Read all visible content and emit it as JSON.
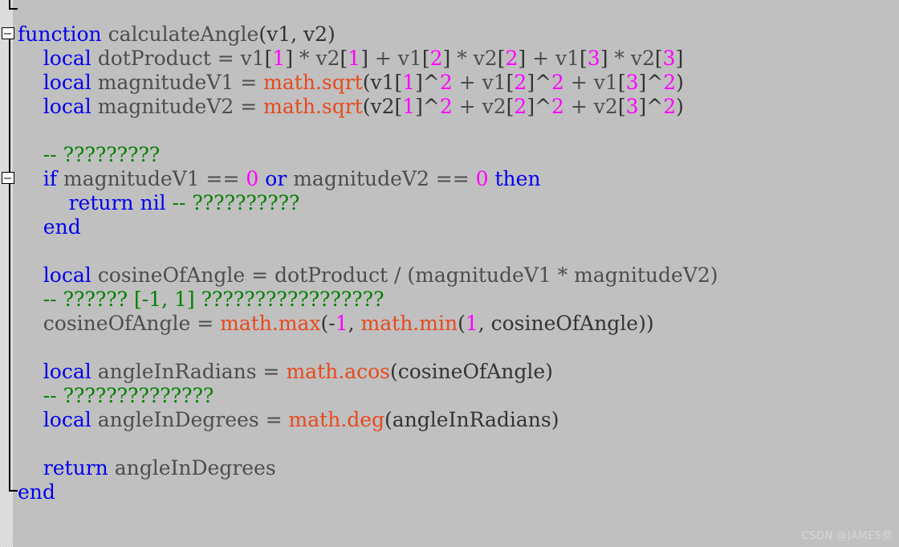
{
  "editor": {
    "background_color": "#c0c0c0",
    "language": "lua",
    "colors": {
      "keyword": "#0000ee",
      "identifier": "#4d4d4d",
      "number": "#ff00ff",
      "library_function": "#e8491d",
      "comment": "#008000",
      "punctuation": "#333333"
    }
  },
  "gutter": {
    "fold_markers": [
      {
        "name": "fold-marker-function",
        "state": "expanded",
        "glyph": "minus"
      },
      {
        "name": "fold-marker-if",
        "state": "expanded",
        "glyph": "minus"
      }
    ]
  },
  "watermark": {
    "text": "CSDN @JAMES费"
  },
  "code": {
    "lines": [
      {
        "indent": 0,
        "tokens": [
          {
            "t": "function",
            "c": "kw"
          },
          {
            "t": " calculateAngle",
            "c": "ident"
          },
          {
            "t": "(v1, v2)",
            "c": "punct"
          }
        ]
      },
      {
        "indent": 4,
        "tokens": [
          {
            "t": "local",
            "c": "kw"
          },
          {
            "t": " dotProduct = v1",
            "c": "ident"
          },
          {
            "t": "[",
            "c": "punct"
          },
          {
            "t": "1",
            "c": "num"
          },
          {
            "t": "]",
            "c": "punct"
          },
          {
            "t": " * v2",
            "c": "ident"
          },
          {
            "t": "[",
            "c": "punct"
          },
          {
            "t": "1",
            "c": "num"
          },
          {
            "t": "]",
            "c": "punct"
          },
          {
            "t": " + v1",
            "c": "ident"
          },
          {
            "t": "[",
            "c": "punct"
          },
          {
            "t": "2",
            "c": "num"
          },
          {
            "t": "]",
            "c": "punct"
          },
          {
            "t": " * v2",
            "c": "ident"
          },
          {
            "t": "[",
            "c": "punct"
          },
          {
            "t": "2",
            "c": "num"
          },
          {
            "t": "]",
            "c": "punct"
          },
          {
            "t": " + v1",
            "c": "ident"
          },
          {
            "t": "[",
            "c": "punct"
          },
          {
            "t": "3",
            "c": "num"
          },
          {
            "t": "]",
            "c": "punct"
          },
          {
            "t": " * v2",
            "c": "ident"
          },
          {
            "t": "[",
            "c": "punct"
          },
          {
            "t": "3",
            "c": "num"
          },
          {
            "t": "]",
            "c": "punct"
          }
        ]
      },
      {
        "indent": 4,
        "tokens": [
          {
            "t": "local",
            "c": "kw"
          },
          {
            "t": " magnitudeV1 = ",
            "c": "ident"
          },
          {
            "t": "math.sqrt",
            "c": "fn"
          },
          {
            "t": "(v1",
            "c": "punct"
          },
          {
            "t": "[",
            "c": "punct"
          },
          {
            "t": "1",
            "c": "num"
          },
          {
            "t": "]^",
            "c": "punct"
          },
          {
            "t": "2",
            "c": "num"
          },
          {
            "t": " + v1",
            "c": "ident"
          },
          {
            "t": "[",
            "c": "punct"
          },
          {
            "t": "2",
            "c": "num"
          },
          {
            "t": "]^",
            "c": "punct"
          },
          {
            "t": "2",
            "c": "num"
          },
          {
            "t": " + v1",
            "c": "ident"
          },
          {
            "t": "[",
            "c": "punct"
          },
          {
            "t": "3",
            "c": "num"
          },
          {
            "t": "]^",
            "c": "punct"
          },
          {
            "t": "2",
            "c": "num"
          },
          {
            "t": ")",
            "c": "punct"
          }
        ]
      },
      {
        "indent": 4,
        "tokens": [
          {
            "t": "local",
            "c": "kw"
          },
          {
            "t": " magnitudeV2 = ",
            "c": "ident"
          },
          {
            "t": "math.sqrt",
            "c": "fn"
          },
          {
            "t": "(v2",
            "c": "punct"
          },
          {
            "t": "[",
            "c": "punct"
          },
          {
            "t": "1",
            "c": "num"
          },
          {
            "t": "]^",
            "c": "punct"
          },
          {
            "t": "2",
            "c": "num"
          },
          {
            "t": " + v2",
            "c": "ident"
          },
          {
            "t": "[",
            "c": "punct"
          },
          {
            "t": "2",
            "c": "num"
          },
          {
            "t": "]^",
            "c": "punct"
          },
          {
            "t": "2",
            "c": "num"
          },
          {
            "t": " + v2",
            "c": "ident"
          },
          {
            "t": "[",
            "c": "punct"
          },
          {
            "t": "3",
            "c": "num"
          },
          {
            "t": "]^",
            "c": "punct"
          },
          {
            "t": "2",
            "c": "num"
          },
          {
            "t": ")",
            "c": "punct"
          }
        ]
      },
      {
        "indent": 0,
        "tokens": []
      },
      {
        "indent": 4,
        "tokens": [
          {
            "t": "-- ?????????",
            "c": "comment"
          }
        ]
      },
      {
        "indent": 4,
        "tokens": [
          {
            "t": "if",
            "c": "kw"
          },
          {
            "t": " magnitudeV1 == ",
            "c": "ident"
          },
          {
            "t": "0",
            "c": "num"
          },
          {
            "t": " ",
            "c": "ident"
          },
          {
            "t": "or",
            "c": "kw"
          },
          {
            "t": " magnitudeV2 == ",
            "c": "ident"
          },
          {
            "t": "0",
            "c": "num"
          },
          {
            "t": " ",
            "c": "ident"
          },
          {
            "t": "then",
            "c": "kw"
          }
        ]
      },
      {
        "indent": 8,
        "tokens": [
          {
            "t": "return",
            "c": "kw"
          },
          {
            "t": " ",
            "c": "ident"
          },
          {
            "t": "nil",
            "c": "kw"
          },
          {
            "t": " ",
            "c": "ident"
          },
          {
            "t": "-- ??????????",
            "c": "comment"
          }
        ]
      },
      {
        "indent": 4,
        "tokens": [
          {
            "t": "end",
            "c": "kw"
          }
        ]
      },
      {
        "indent": 0,
        "tokens": []
      },
      {
        "indent": 4,
        "tokens": [
          {
            "t": "local",
            "c": "kw"
          },
          {
            "t": " cosineOfAngle = dotProduct / (magnitudeV1 * magnitudeV2)",
            "c": "ident"
          }
        ]
      },
      {
        "indent": 4,
        "tokens": [
          {
            "t": "-- ?????? [-1, 1] ?????????????????",
            "c": "comment"
          }
        ]
      },
      {
        "indent": 4,
        "tokens": [
          {
            "t": "cosineOfAngle = ",
            "c": "ident"
          },
          {
            "t": "math.max",
            "c": "fn"
          },
          {
            "t": "(-",
            "c": "punct"
          },
          {
            "t": "1",
            "c": "num"
          },
          {
            "t": ", ",
            "c": "punct"
          },
          {
            "t": "math.min",
            "c": "fn"
          },
          {
            "t": "(",
            "c": "punct"
          },
          {
            "t": "1",
            "c": "num"
          },
          {
            "t": ", cosineOfAngle))",
            "c": "punct"
          }
        ]
      },
      {
        "indent": 0,
        "tokens": []
      },
      {
        "indent": 4,
        "tokens": [
          {
            "t": "local",
            "c": "kw"
          },
          {
            "t": " angleInRadians = ",
            "c": "ident"
          },
          {
            "t": "math.acos",
            "c": "fn"
          },
          {
            "t": "(cosineOfAngle)",
            "c": "punct"
          }
        ]
      },
      {
        "indent": 4,
        "tokens": [
          {
            "t": "-- ??????????????",
            "c": "comment"
          }
        ]
      },
      {
        "indent": 4,
        "tokens": [
          {
            "t": "local",
            "c": "kw"
          },
          {
            "t": " angleInDegrees = ",
            "c": "ident"
          },
          {
            "t": "math.deg",
            "c": "fn"
          },
          {
            "t": "(angleInRadians)",
            "c": "punct"
          }
        ]
      },
      {
        "indent": 0,
        "tokens": []
      },
      {
        "indent": 4,
        "tokens": [
          {
            "t": "return",
            "c": "kw"
          },
          {
            "t": " angleInDegrees",
            "c": "ident"
          }
        ]
      },
      {
        "indent": 0,
        "tokens": [
          {
            "t": "end",
            "c": "kw"
          }
        ]
      }
    ]
  }
}
